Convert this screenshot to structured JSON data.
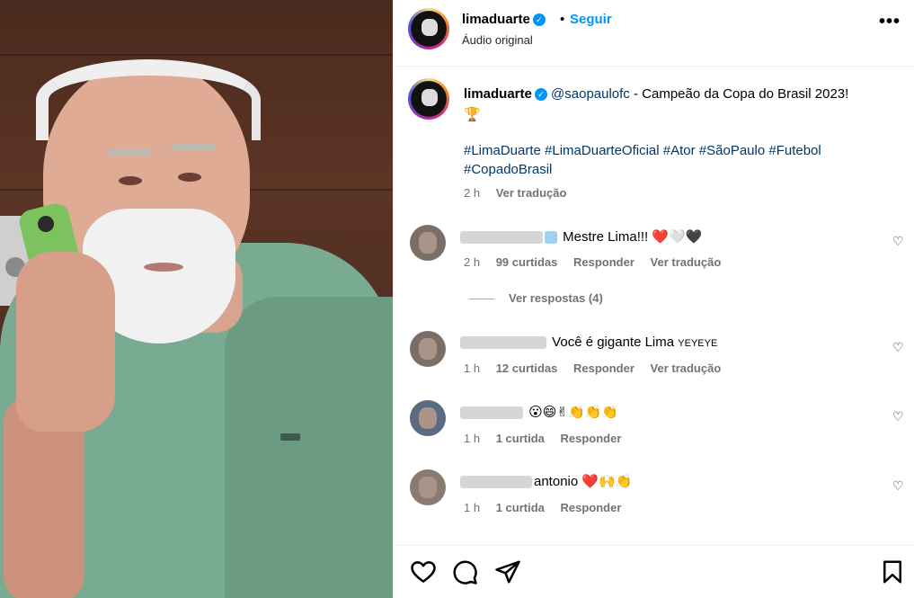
{
  "post": {
    "username": "limaduarte",
    "follow_label": "Seguir",
    "dot": "•",
    "audio": "Áudio original",
    "more_label": "•••"
  },
  "caption": {
    "username": "limaduarte",
    "mention": "@saopaulofc",
    "text": " - Campeão da Copa do Brasil 2023!",
    "emoji": "🏆",
    "hashtags": "#LimaDuarte #LimaDuarteOficial #Ator #SãoPaulo #Futebol #CopadoBrasil",
    "time": "2 h",
    "translate": "Ver tradução"
  },
  "comments": [
    {
      "text": "Mestre Lima!!! ",
      "emoji": "❤️🤍🖤",
      "time": "2 h",
      "likes": "99 curtidas",
      "reply": "Responder",
      "translate": "Ver tradução",
      "view_replies": "Ver respostas (4)"
    },
    {
      "text": "Você é gigante Lima ",
      "emoji": "YEYEYE",
      "time": "1 h",
      "likes": "12 curtidas",
      "reply": "Responder",
      "translate": "Ver tradução"
    },
    {
      "text": "",
      "emoji": "😮😄✌👏👏👏",
      "time": "1 h",
      "likes": "1 curtida",
      "reply": "Responder"
    },
    {
      "text": "antonio ",
      "emoji": "❤️🙌👏",
      "time": "1 h",
      "likes": "1 curtida",
      "reply": "Responder"
    }
  ],
  "icons": {
    "like": "heart-icon",
    "comment": "comment-icon",
    "share": "share-icon",
    "save": "bookmark-icon",
    "verified": "verified-icon",
    "small_heart": "♡"
  },
  "colors": {
    "link": "#0095f6",
    "hashtag": "#00376b",
    "muted": "#737373",
    "verified": "#0095f6"
  }
}
